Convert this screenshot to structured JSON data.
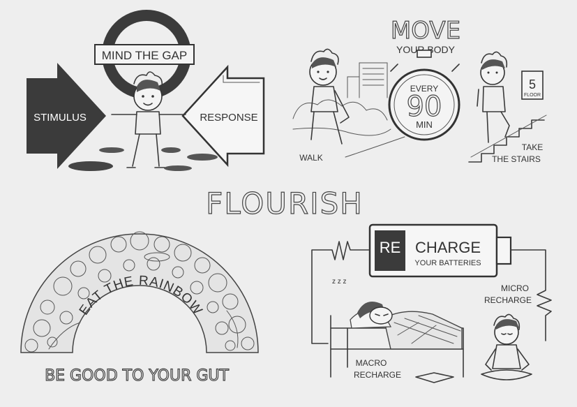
{
  "title": "FLOURISH",
  "panel_mind": {
    "sign": "MIND THE GAP",
    "left_arrow": "STIMULUS",
    "right_arrow": "RESPONSE"
  },
  "panel_move": {
    "heading": "MOVE",
    "subheading": "YOUR BODY",
    "timer_top": "EVERY",
    "timer_num": "90",
    "timer_unit": "MIN",
    "walk": "WALK",
    "floor_num": "5",
    "floor_label": "FLOOR",
    "stairs_1": "TAKE",
    "stairs_2": "THE STAIRS"
  },
  "panel_gut": {
    "arc_text": "EAT THE RAINBOW",
    "caption": "BE GOOD TO YOUR GUT"
  },
  "panel_recharge": {
    "re": "RE",
    "charge": "CHARGE",
    "sub": "YOUR BATTERIES",
    "micro_1": "MICRO",
    "micro_2": "RECHARGE",
    "macro_1": "MACRO",
    "macro_2": "RECHARGE"
  }
}
